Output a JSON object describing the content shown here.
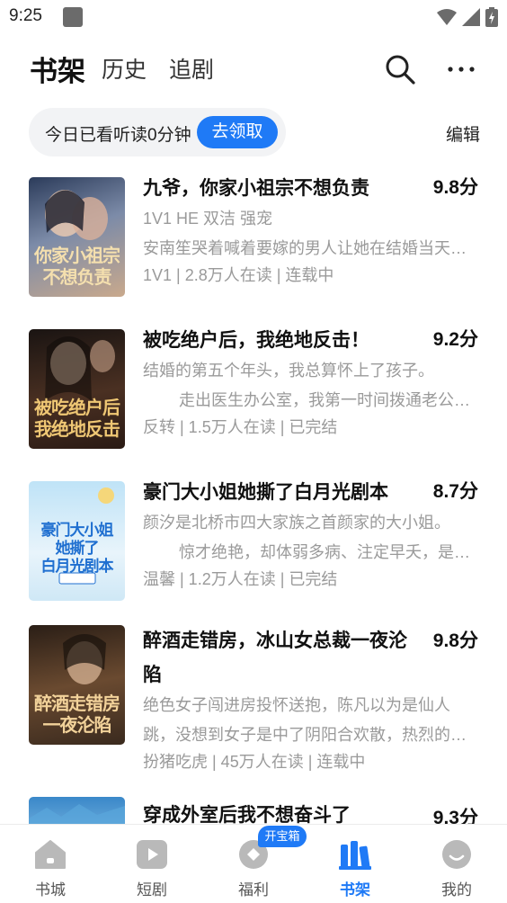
{
  "status_bar": {
    "time": "9:25"
  },
  "header": {
    "tabs": [
      {
        "label": "书架",
        "active": true
      },
      {
        "label": "历史",
        "active": false
      },
      {
        "label": "追剧",
        "active": false
      }
    ]
  },
  "banner": {
    "text": "今日已看听读0分钟",
    "claim_label": "去领取",
    "edit_label": "编辑"
  },
  "books": [
    {
      "title": "九爷，你家小祖宗不想负责",
      "score": "9.8分",
      "line1": "1V1  HE 双洁  强宠",
      "line2": "安南笙哭着喊着要嫁的男人让她在结婚当天…",
      "meta": "1V1 | 2.8万人在读 | 连载中",
      "cover_text": "你家小祖宗\n不想负责",
      "cover_colors": [
        "#2b3b5a",
        "#7c8ba8",
        "#d9b98a"
      ]
    },
    {
      "title": "被吃绝户后，我绝地反击！",
      "score": "9.2分",
      "line1": "结婚的第五个年头，我总算怀上了孩子。",
      "line2": "        走出医生办公室，我第一时间拨通老公…",
      "meta": "反转 | 1.5万人在读 | 已完结",
      "cover_text": "被吃绝户后\n我绝地反击",
      "cover_colors": [
        "#1a1412",
        "#5b3a2a",
        "#e8c37a"
      ]
    },
    {
      "title": "豪门大小姐她撕了白月光剧本",
      "score": "8.7分",
      "line1": "颜汐是北桥市四大家族之首颜家的大小姐。",
      "line2": "        惊才绝艳，却体弱多病、注定早夭，是…",
      "meta": "温馨 | 1.2万人在读 | 已完结",
      "cover_text": "豪门大小姐\n她撕了\n白月光剧本",
      "cover_colors": [
        "#bfe3f7",
        "#e8f4fb",
        "#1f6fd0"
      ]
    },
    {
      "title": "醉酒走错房，冰山女总裁一夜沦陷",
      "score": "9.8分",
      "line1": "绝色女子闯进房投怀送抱，陈凡以为是仙人",
      "line2": "跳，没想到女子是中了阴阳合欢散，热烈的…",
      "meta": "扮猪吃虎 | 45万人在读 | 连载中",
      "cover_text": "醉酒走错房\n一夜沦陷",
      "cover_colors": [
        "#2a1e16",
        "#6a4a30",
        "#f2d29a"
      ]
    },
    {
      "title": "穿成外室后我不想奋斗了",
      "score": "9.3分",
      "line1": "",
      "line2": "",
      "meta": "",
      "cover_text": "",
      "cover_colors": [
        "#3a88c9",
        "#a6d3ef",
        "#eaf5fb"
      ]
    }
  ],
  "bottom_nav": {
    "items": [
      {
        "label": "书城",
        "icon": "home-icon",
        "active": false
      },
      {
        "label": "短剧",
        "icon": "play-icon",
        "active": false
      },
      {
        "label": "福利",
        "icon": "gift-icon",
        "active": false
      },
      {
        "label": "书架",
        "icon": "bookshelf-icon",
        "active": true
      },
      {
        "label": "我的",
        "icon": "profile-icon",
        "active": false
      }
    ],
    "badge": "开宝箱"
  },
  "colors": {
    "accent": "#1f7af6",
    "muted": "#9a9a9a"
  }
}
